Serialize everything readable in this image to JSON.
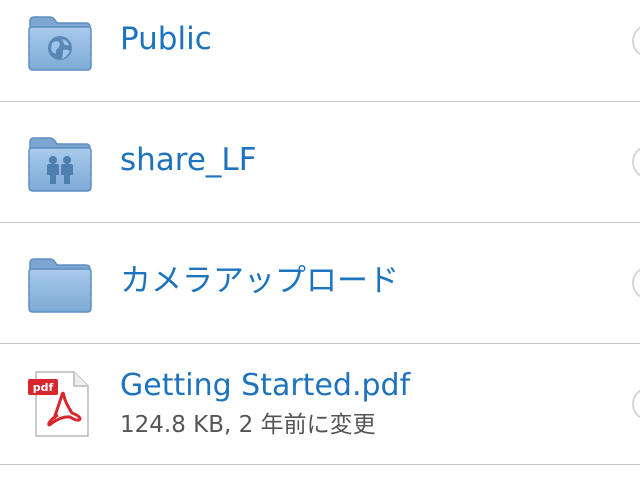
{
  "files": [
    {
      "name": "Public",
      "meta": "",
      "icon": "public-folder-icon"
    },
    {
      "name": "share_LF",
      "meta": "",
      "icon": "shared-folder-icon"
    },
    {
      "name": "カメラアップロード",
      "meta": "",
      "icon": "folder-icon"
    },
    {
      "name": "Getting Started.pdf",
      "meta": "124.8 KB, 2 年前に変更",
      "icon": "pdf-file-icon"
    }
  ],
  "colors": {
    "link_blue": "#1d73bd",
    "folder_blue": "#8fb7dd",
    "folder_blue_dark": "#5e8fc0",
    "pdf_red": "#d7262d",
    "divider": "#c8c8c8"
  }
}
